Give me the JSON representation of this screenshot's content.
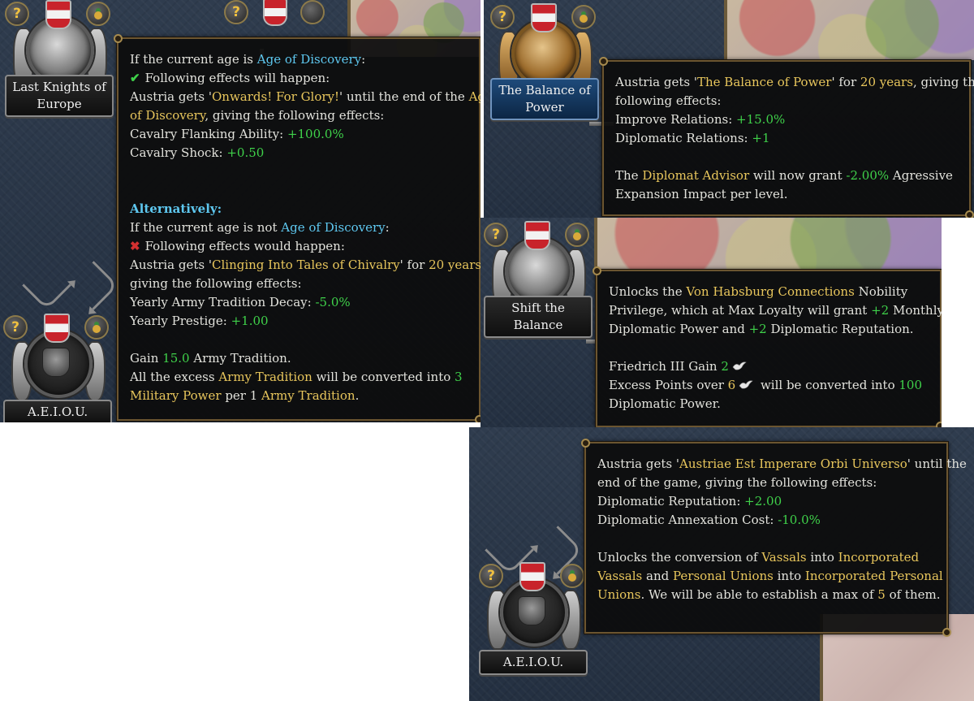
{
  "ideas": {
    "last_knights": "Last Knights of Europe",
    "balance_of_power": "The Balance of Power",
    "shift_balance": "Shift the Balance",
    "aeiou_left": "A.E.I.O.U.",
    "aeiou_right": "A.E.I.O.U.",
    "partial_top_left": "?",
    "help_badge": "?"
  },
  "tooltip1": {
    "l1_a": "If the current age is ",
    "l1_b": "Age of Discovery",
    "l1_c": ":",
    "l2": "Following effects will happen:",
    "l3_a": "Austria gets '",
    "l3_b": "Onwards! For Glory!",
    "l3_c": "' until the end of the ",
    "l3_d": "Age",
    "l4_a": "of Discovery",
    "l4_b": ", giving the following effects:",
    "l5_a": "Cavalry Flanking Ability: ",
    "l5_b": "+100.0%",
    "l6_a": "Cavalry Shock: ",
    "l6_b": "+0.50",
    "alt": "Alternatively:",
    "l7_a": "If the current age is not ",
    "l7_b": "Age of Discovery",
    "l7_c": ":",
    "l8": "Following effects would happen:",
    "l9_a": "Austria gets '",
    "l9_b": "Clinging Into Tales of Chivalry",
    "l9_c": "' for ",
    "l9_d": "20 years",
    "l9_e": ",",
    "l10": "giving the following effects:",
    "l11_a": "Yearly Army Tradition Decay: ",
    "l11_b": "-5.0%",
    "l12_a": "Yearly Prestige: ",
    "l12_b": "+1.00",
    "l13_a": "Gain ",
    "l13_b": "15.0",
    "l13_c": " Army Tradition.",
    "l14_a": "All the excess ",
    "l14_b": "Army Tradition",
    "l14_c": " will be converted into ",
    "l14_d": "3",
    "l15_a": "Military Power",
    "l15_b": " per 1 ",
    "l15_c": "Army Tradition",
    "l15_d": "."
  },
  "tooltip2": {
    "l1_a": "Austria gets '",
    "l1_b": "The Balance of Power",
    "l1_c": "' for ",
    "l1_d": "20 years",
    "l1_e": ", giving the",
    "l2": "following effects:",
    "l3_a": "Improve Relations: ",
    "l3_b": "+15.0%",
    "l4_a": "Diplomatic Relations: ",
    "l4_b": "+1",
    "l5_a": "The ",
    "l5_b": "Diplomat Advisor",
    "l5_c": " will now grant ",
    "l5_d": "-2.00%",
    "l5_e": " Agressive",
    "l6": "Expansion Impact per level."
  },
  "tooltip3": {
    "l1_a": "Unlocks the ",
    "l1_b": "Von Habsburg Connections",
    "l1_c": " Nobility",
    "l2_a": "Privilege, which at Max Loyalty will grant ",
    "l2_b": "+2",
    "l2_c": " Monthly",
    "l3_a": "Diplomatic Power and ",
    "l3_b": "+2",
    "l3_c": " Diplomatic Reputation.",
    "l4_a": "Friedrich III Gain ",
    "l4_b": "2",
    "l5_a": "Excess Points over ",
    "l5_b": "6",
    "l5_c": " will be converted into ",
    "l5_d": "100",
    "l6": "Diplomatic Power."
  },
  "tooltip4": {
    "l1_a": "Austria gets '",
    "l1_b": "Austriae Est Imperare Orbi Universo",
    "l1_c": "' until the",
    "l2": "end of the game, giving the following effects:",
    "l3_a": "Diplomatic Reputation: ",
    "l3_b": "+2.00",
    "l4_a": "Diplomatic Annexation Cost: ",
    "l4_b": "-10.0%",
    "l5_a": "Unlocks the conversion of ",
    "l5_b": "Vassals",
    "l5_c": " into ",
    "l5_d": "Incorporated",
    "l6_a": "Vassals",
    "l6_b": " and ",
    "l6_c": "Personal Unions",
    "l6_d": " into ",
    "l6_e": "Incorporated Personal",
    "l7_a": "Unions",
    "l7_b": ". We will be able to establish a max of ",
    "l7_c": "5",
    "l7_d": " of them."
  },
  "colors": {
    "highlight_yellow": "#e8c65c",
    "highlight_blue": "#5ec8f0",
    "positive_green": "#3fd14a",
    "negative_red": "#d23030",
    "tooltip_bg": "#0c0c0c",
    "panel_bg": "#2a3646"
  },
  "icons": [
    "help-icon",
    "austria-shield-icon",
    "medal-icon",
    "checkmark-icon",
    "cross-icon",
    "dove-diplomat-icon",
    "arrow-icon"
  ]
}
